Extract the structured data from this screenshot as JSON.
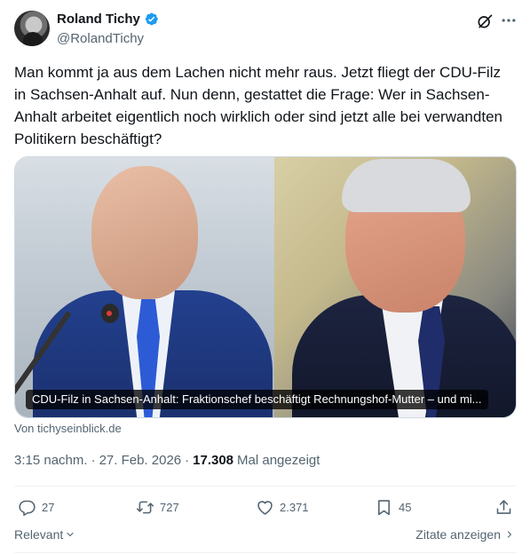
{
  "author": {
    "name": "Roland Tichy",
    "handle": "@RolandTichy",
    "verified": true
  },
  "tweet": {
    "text": "Man kommt ja aus dem Lachen nicht mehr raus. Jetzt fliegt der CDU-Filz in Sachsen-Anhalt auf. Nun denn, gestattet die Frage: Wer in Sachsen-Anhalt arbeitet eigentlich noch wirklich oder sind jetzt alle bei verwandten Politikern beschäftigt?",
    "link_card": {
      "caption": "CDU-Filz in Sachsen-Anhalt: Fraktionschef beschäftigt Rechnungshof-Mutter – und mi...",
      "source": "Von tichyseinblick.de"
    },
    "meta": {
      "time": "3:15 nachm.",
      "separator": "·",
      "date": "27. Feb. 2026",
      "views_count": "17.308",
      "views_label": "Mal angezeigt"
    }
  },
  "actions": {
    "reply_count": "27",
    "retweet_count": "727",
    "like_count": "2.371",
    "bookmark_count": "45"
  },
  "footer": {
    "sort_label": "Relevant",
    "quotes_label": "Zitate anzeigen"
  },
  "colors": {
    "text_primary": "#0f1419",
    "text_secondary": "#536471",
    "verified_blue": "#1d9bf0",
    "divider": "#eff3f4"
  },
  "icons": {
    "verified": "verified-badge-icon",
    "grok": "grok-icon",
    "more": "more-icon",
    "reply": "reply-icon",
    "retweet": "retweet-icon",
    "like": "heart-icon",
    "bookmark": "bookmark-icon",
    "share": "share-icon"
  }
}
